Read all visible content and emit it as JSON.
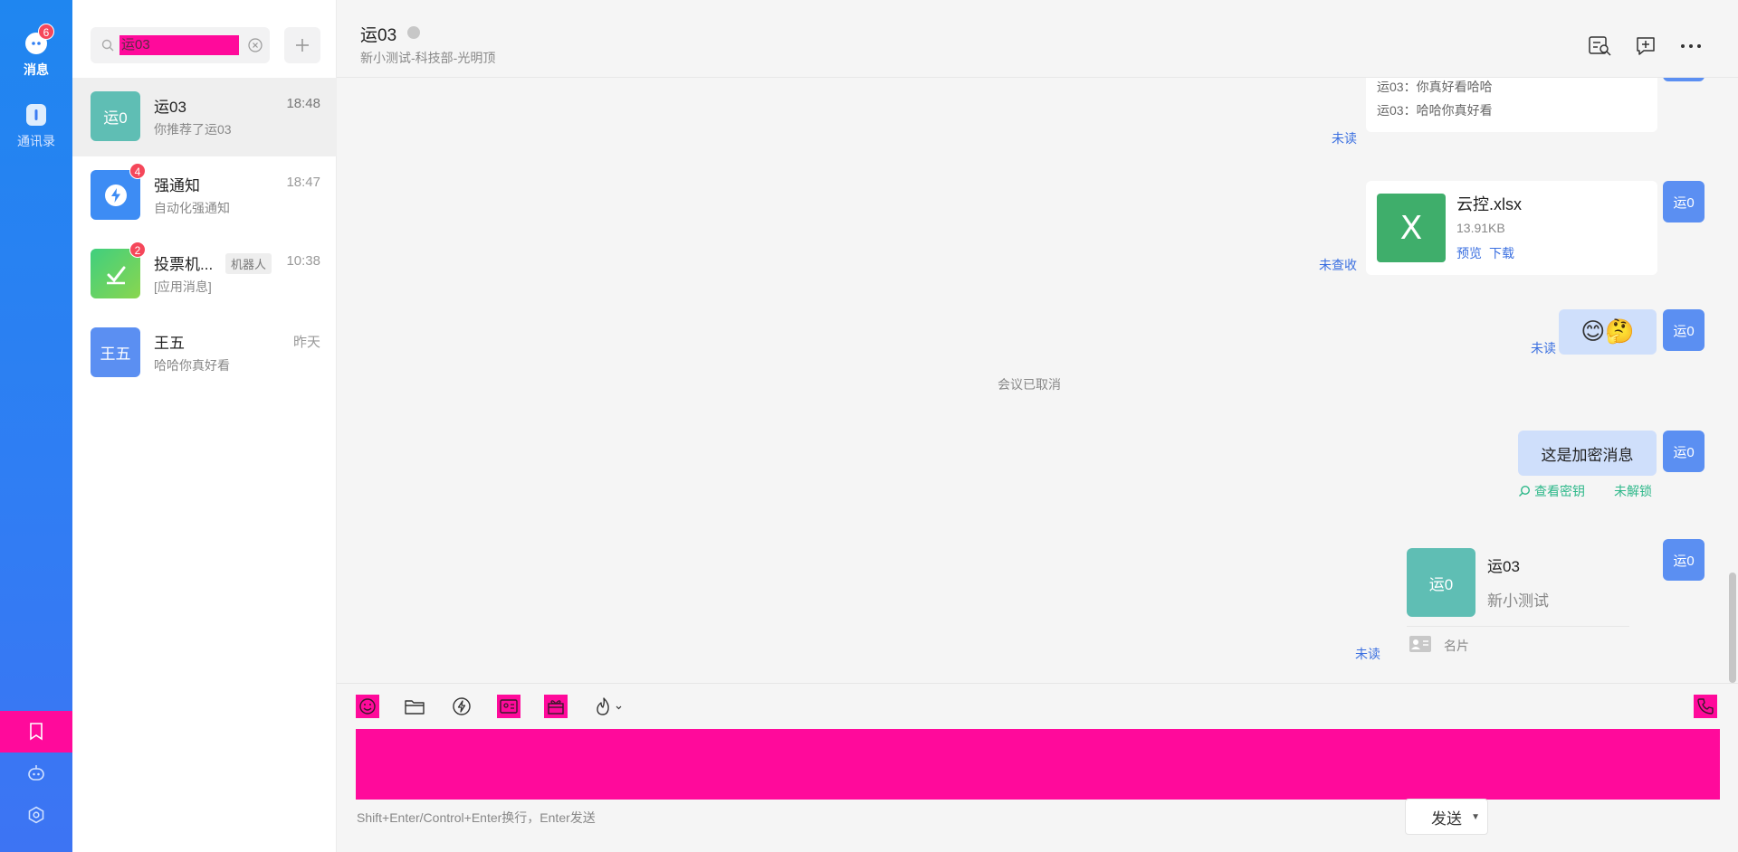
{
  "rail": {
    "messages_label": "消息",
    "messages_badge": "6",
    "contacts_label": "通讯录"
  },
  "search": {
    "value": "运03"
  },
  "conversations": [
    {
      "avatar": "运0",
      "name": "运03",
      "time": "18:48",
      "preview": "你推荐了运03",
      "badge": "",
      "tag": ""
    },
    {
      "avatar": "",
      "name": "强通知",
      "time": "18:47",
      "preview": "自动化强通知",
      "badge": "4",
      "tag": ""
    },
    {
      "avatar": "",
      "name": "投票机...",
      "time": "10:38",
      "preview": "[应用消息]",
      "badge": "2",
      "tag": "机器人"
    },
    {
      "avatar": "王五",
      "name": "王五",
      "time": "昨天",
      "preview": "哈哈你真好看",
      "badge": "",
      "tag": ""
    }
  ],
  "chat": {
    "title": "运03",
    "subtitle": "新小测试-科技部-光明顶"
  },
  "messages": {
    "my_avatar": "运0",
    "quote_lines": [
      "运03：你真好看哈哈",
      "运03：哈哈你真好看"
    ],
    "quote_status": "未读",
    "file": {
      "icon_letter": "X",
      "name": "云控.xlsx",
      "size": "13.91KB",
      "preview": "预览",
      "download": "下载",
      "status": "未查收"
    },
    "emoji": {
      "text": "😊🤔",
      "status": "未读"
    },
    "system_note": "会议已取消",
    "encrypted": {
      "text": "这是加密消息",
      "view_key": "查看密钥",
      "lock_status": "未解锁"
    },
    "card": {
      "avatar": "运0",
      "name": "运03",
      "org": "新小测试",
      "label": "名片",
      "status": "未读"
    }
  },
  "composer": {
    "hint": "Shift+Enter/Control+Enter换行，Enter发送",
    "send_label": "发送"
  },
  "colors": {
    "rail_blue": "#2f7ef3",
    "redaction_pink": "#ff0a9b",
    "badge_red": "#f5475a",
    "link_blue": "#3a6fe0",
    "green": "#2eb88a",
    "excel_green": "#3fae6b"
  },
  "icons": [
    "chat-bubble-icon",
    "contacts-icon",
    "bookmark-icon",
    "robot-icon",
    "settings-icon",
    "search-icon",
    "clear-icon",
    "plus-icon",
    "search-history-icon",
    "add-chat-icon",
    "more-icon",
    "emoji-icon",
    "folder-icon",
    "lightning-icon",
    "contact-card-icon",
    "gift-icon",
    "flame-icon",
    "phone-icon"
  ]
}
